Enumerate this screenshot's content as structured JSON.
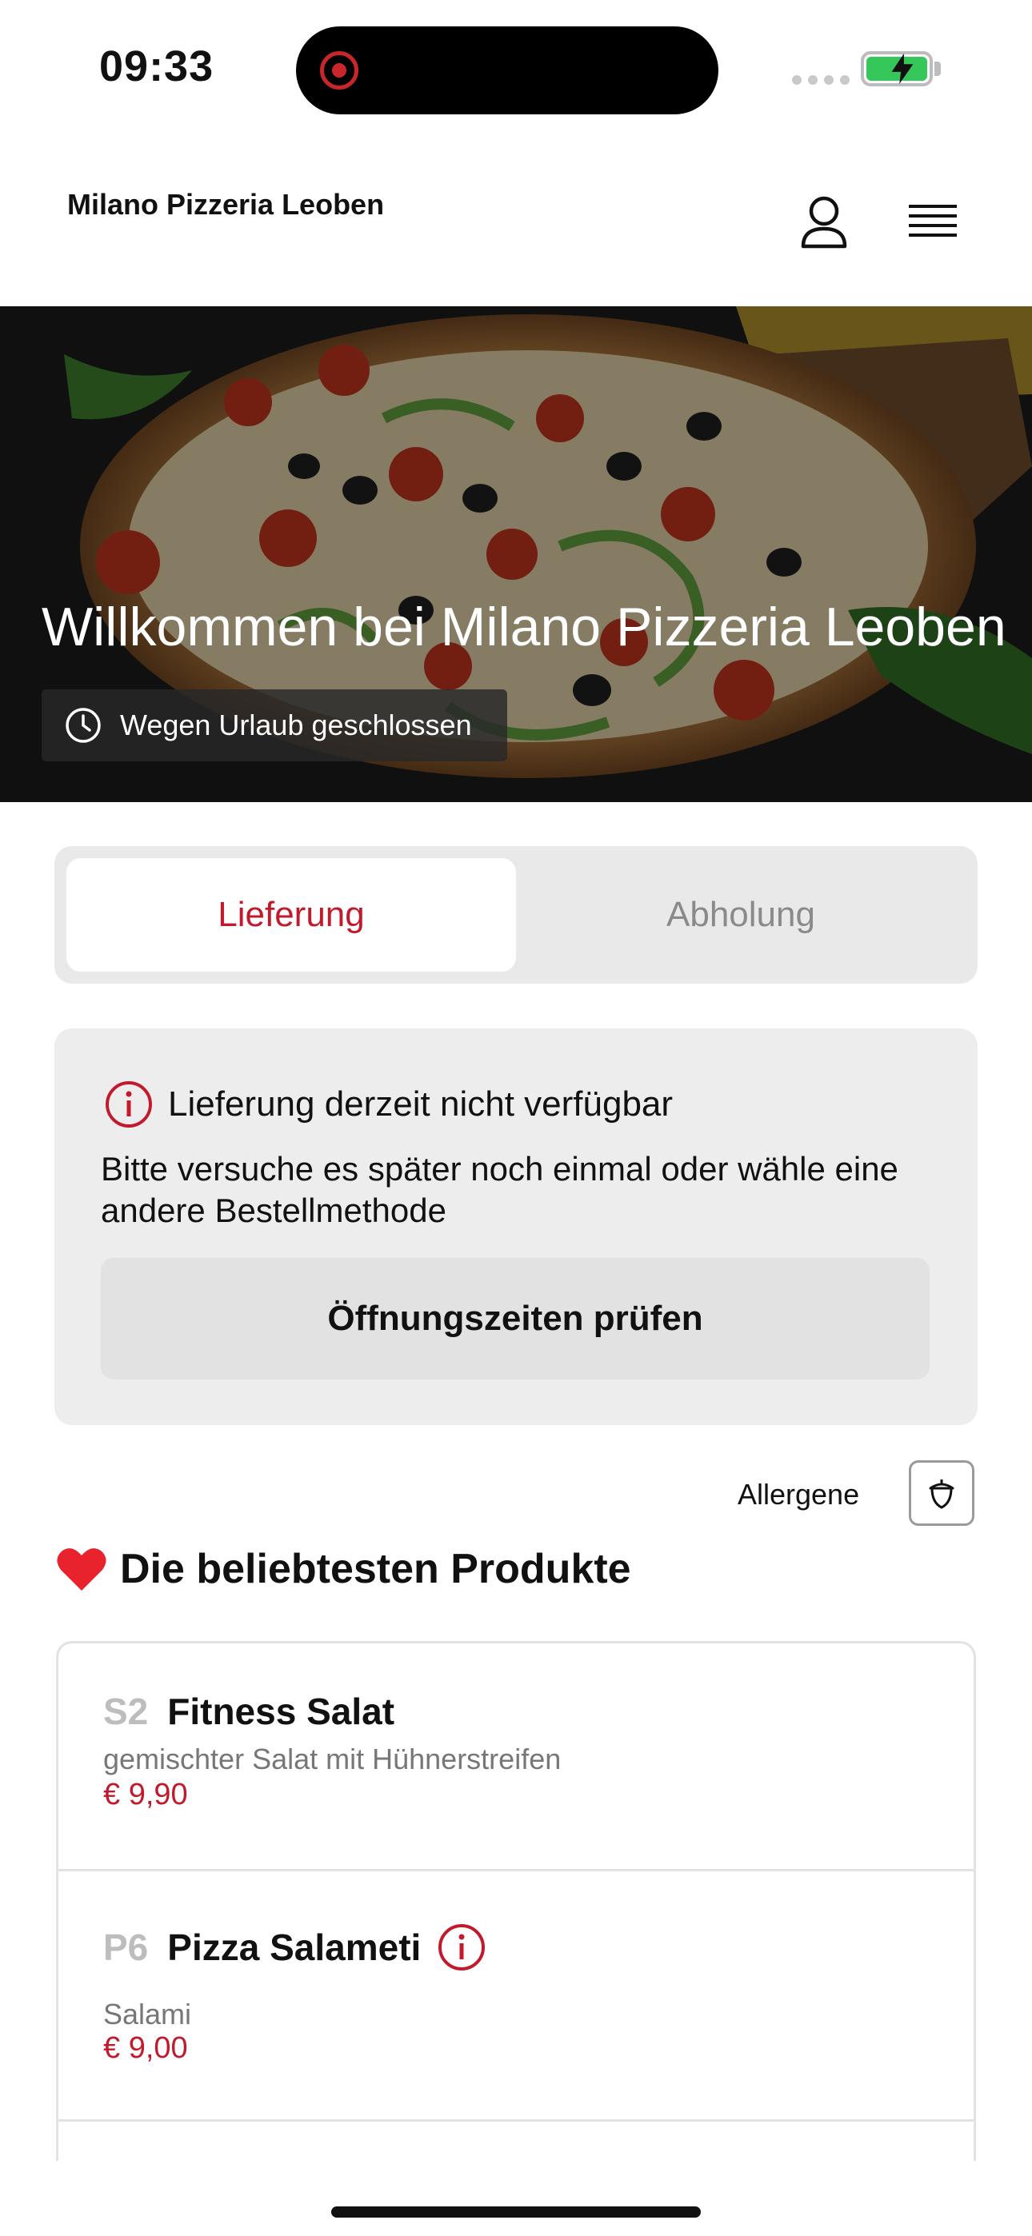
{
  "status_bar": {
    "time": "09:33"
  },
  "header": {
    "brand": "Milano Pizzeria Leoben"
  },
  "hero": {
    "title": "Willkommen bei Milano Pizzeria Leoben",
    "status": "Wegen Urlaub geschlossen"
  },
  "order_mode": {
    "options": [
      "Lieferung",
      "Abholung"
    ],
    "selected": "Lieferung"
  },
  "notice": {
    "title": "Lieferung derzeit nicht verfügbar",
    "body": "Bitte versuche es später noch einmal oder wähle eine andere Bestellmethode",
    "button": "Öffnungszeiten prüfen"
  },
  "allergens": {
    "label": "Allergene"
  },
  "popular": {
    "title": "Die beliebtesten Produkte",
    "products": [
      {
        "code": "S2",
        "name": "Fitness Salat",
        "description": "gemischter Salat mit Hühnerstreifen",
        "price": "€ 9,90"
      },
      {
        "code": "P6",
        "name": "Pizza Salameti",
        "description": "Salami",
        "price": "€ 9,00"
      }
    ]
  },
  "colors": {
    "accent": "#c11a2c",
    "panel": "#ededed",
    "segment": "#e9e9e9"
  }
}
